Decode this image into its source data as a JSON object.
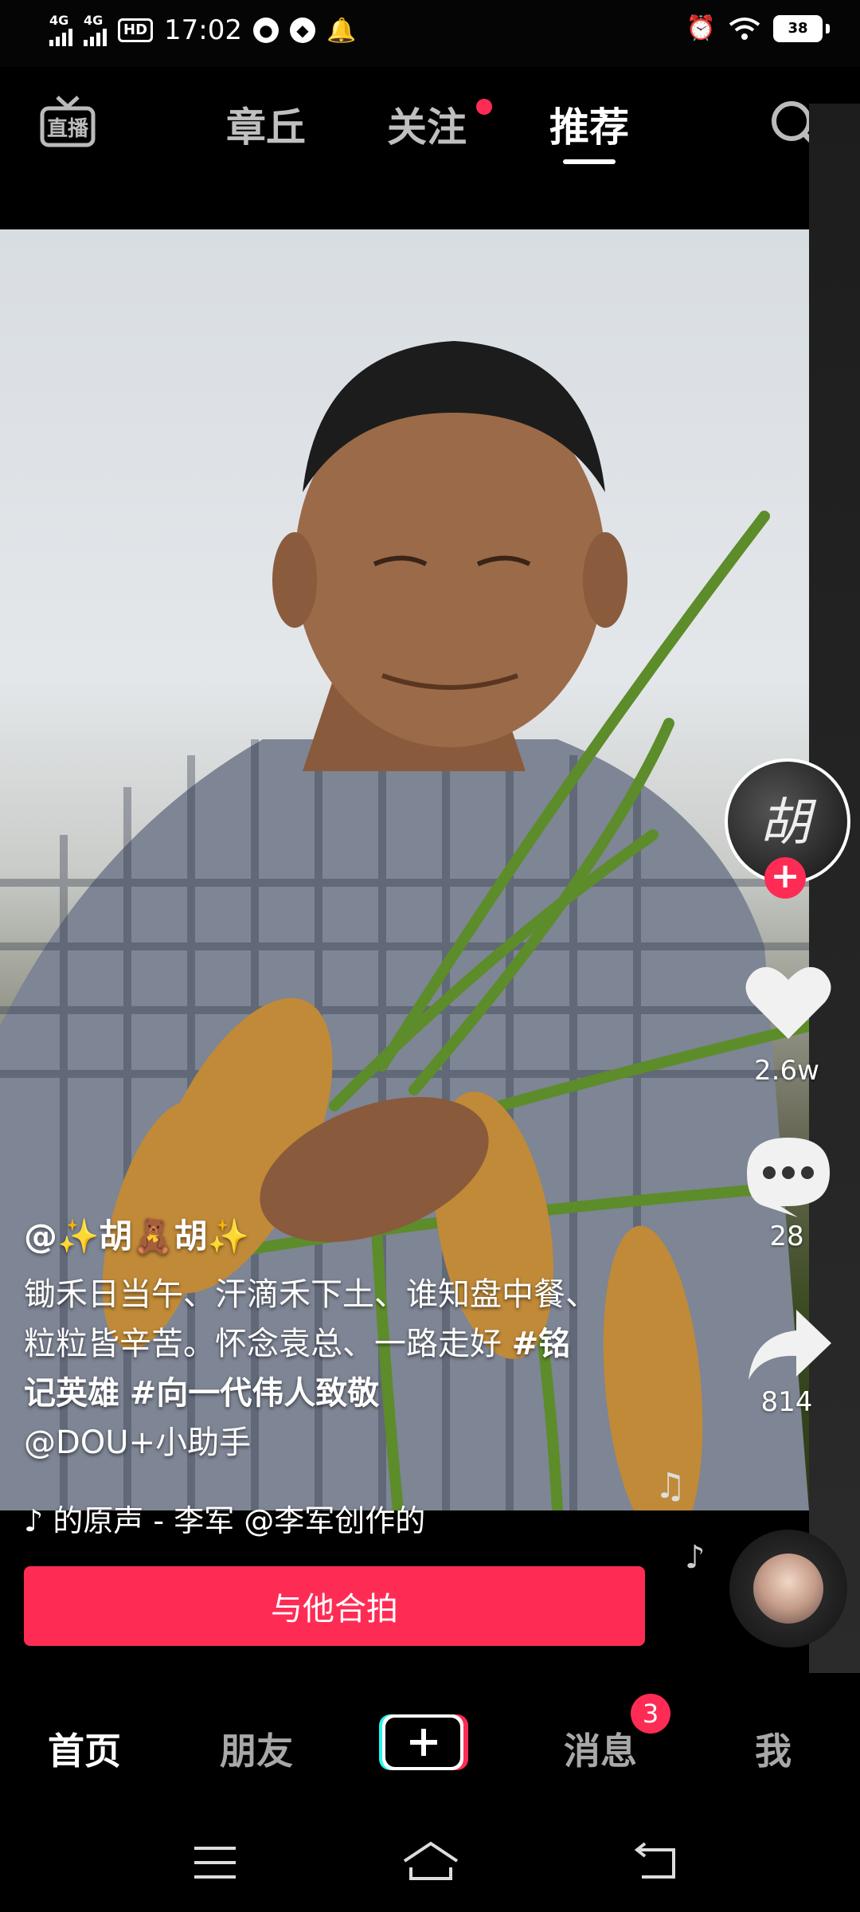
{
  "status_bar": {
    "net1": "4G",
    "net2": "4G",
    "hd": "HD",
    "time": "17:02",
    "battery": "38"
  },
  "top_nav": {
    "tabs": [
      "章丘",
      "关注",
      "推荐"
    ],
    "active_tab": "推荐",
    "live_label": "直播"
  },
  "right_rail": {
    "avatar_text": "胡",
    "likes": "2.6w",
    "comments": "28",
    "shares": "814"
  },
  "post": {
    "author": "@✨胡🧸胡✨",
    "caption_text": "锄禾日当午、汗滴禾下土、谁知盘中餐、粒粒皆辛苦。怀念袁总、一路走好",
    "hashtag1": "#铭记英雄",
    "hashtag2": "#向一代伟人致敬",
    "mention": "@DOU+小助手",
    "music": "的原声 - 李军    @李军创作的"
  },
  "duet_button": "与他合拍",
  "bottom_nav": {
    "home": "首页",
    "friends": "朋友",
    "messages": "消息",
    "messages_badge": "3",
    "me": "我"
  },
  "colors": {
    "accent": "#fe2c55",
    "background": "#000000"
  }
}
